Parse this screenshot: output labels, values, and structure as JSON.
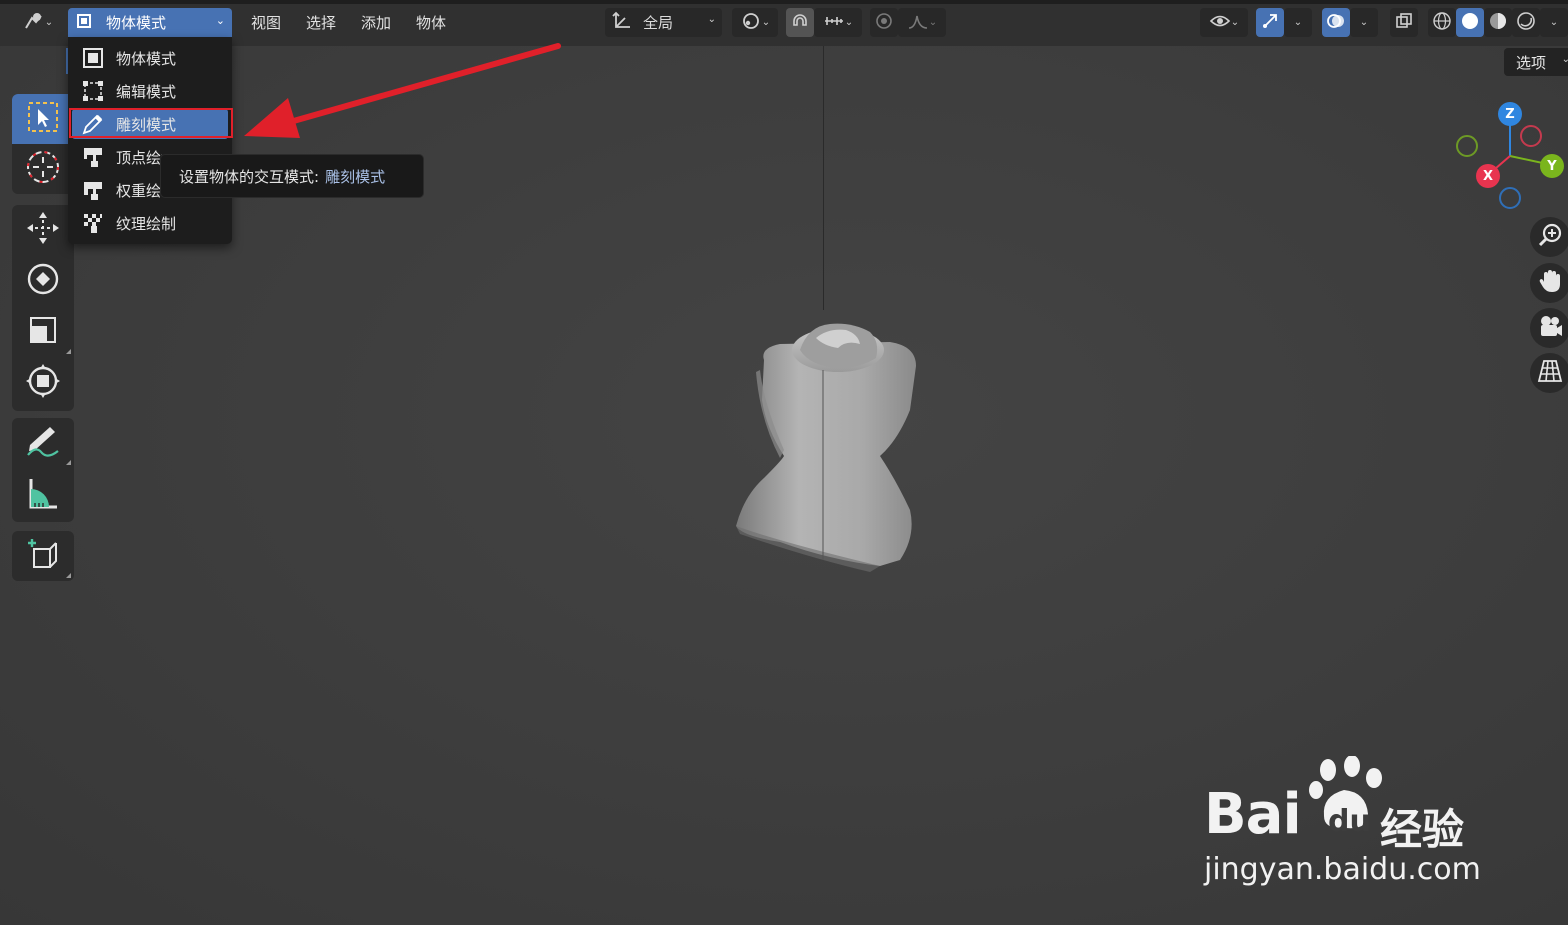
{
  "header": {
    "mode_label": "物体模式",
    "menus": [
      "视图",
      "选择",
      "添加",
      "物体"
    ],
    "orientation_label": "全局",
    "options_label": "选项"
  },
  "mode_menu": {
    "items": [
      {
        "label": "物体模式",
        "icon": "object-mode-icon"
      },
      {
        "label": "编辑模式",
        "icon": "edit-mode-icon"
      },
      {
        "label": "雕刻模式",
        "icon": "sculpt-mode-icon",
        "active": true
      },
      {
        "label": "顶点绘制",
        "icon": "vertex-paint-icon"
      },
      {
        "label": "权重绘制",
        "icon": "weight-paint-icon"
      },
      {
        "label": "纹理绘制",
        "icon": "texture-paint-icon"
      }
    ]
  },
  "tooltip": {
    "text": "设置物体的交互模式:",
    "value": "雕刻模式"
  },
  "gizmo": {
    "x": "X",
    "y": "Y",
    "z": "Z"
  },
  "colors": {
    "accent": "#4772b3",
    "arrow": "#e0202a",
    "axis_x": "#e8344f",
    "axis_y": "#7ab51d",
    "axis_z": "#2f86e0"
  },
  "watermark": {
    "brand": "Bai",
    "brand_suffix": "du",
    "cn": "经验",
    "url": "jingyan.baidu.com"
  }
}
